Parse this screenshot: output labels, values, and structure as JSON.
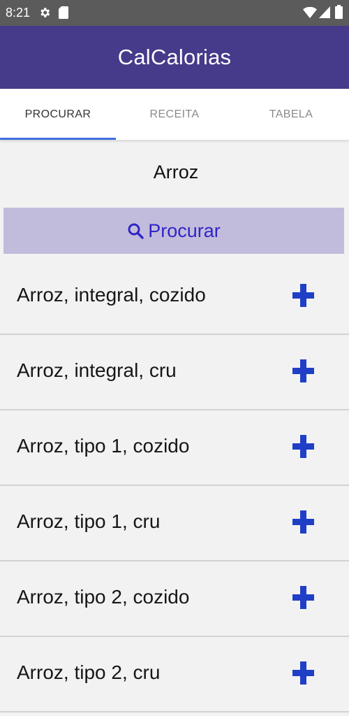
{
  "status_bar": {
    "time": "8:21",
    "icons": [
      "gear-icon",
      "sd-card-icon",
      "wifi-icon",
      "signal-icon",
      "battery-icon"
    ]
  },
  "app_bar": {
    "title": "CalCalorias",
    "color": "#463a8a"
  },
  "tabs": [
    {
      "label": "PROCURAR",
      "selected": true
    },
    {
      "label": "RECEITA",
      "selected": false
    },
    {
      "label": "TABELA",
      "selected": false
    }
  ],
  "search": {
    "value": "Arroz",
    "button_label": "Procurar",
    "button_icon": "search-icon",
    "button_color": "#c2bcdc",
    "accent_color": "#2f25c7"
  },
  "results": [
    {
      "label": "Arroz, integral, cozido",
      "action_icon": "plus-icon"
    },
    {
      "label": "Arroz, integral, cru",
      "action_icon": "plus-icon"
    },
    {
      "label": "Arroz, tipo 1, cozido",
      "action_icon": "plus-icon"
    },
    {
      "label": "Arroz, tipo 1, cru",
      "action_icon": "plus-icon"
    },
    {
      "label": "Arroz, tipo 2, cozido",
      "action_icon": "plus-icon"
    },
    {
      "label": "Arroz, tipo 2, cru",
      "action_icon": "plus-icon"
    }
  ]
}
